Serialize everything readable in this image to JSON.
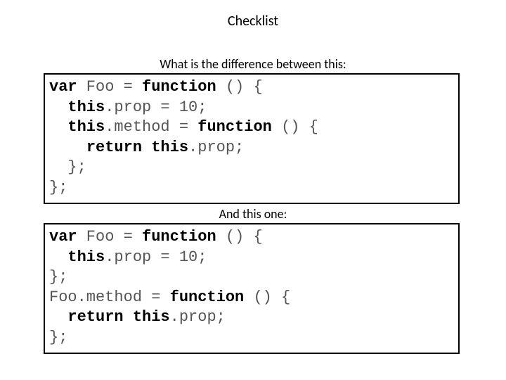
{
  "title": "Checklist",
  "captions": {
    "first": "What is the difference between this:",
    "second": "And this one:"
  },
  "code": {
    "block1": {
      "l1a": "var",
      "l1b": " Foo = ",
      "l1c": "function",
      "l1d": " () {",
      "l2a": "  ",
      "l2b": "this",
      "l2c": ".prop = 10;",
      "l3a": "  ",
      "l3b": "this",
      "l3c": ".method = ",
      "l3d": "function",
      "l3e": " () {",
      "l4a": "    ",
      "l4b": "return this",
      "l4c": ".prop;",
      "l5": "  };",
      "l6": "};"
    },
    "block2": {
      "l1a": "var",
      "l1b": " Foo = ",
      "l1c": "function",
      "l1d": " () {",
      "l2a": "  ",
      "l2b": "this",
      "l2c": ".prop = 10;",
      "l3": "};",
      "l4a": "Foo.method = ",
      "l4b": "function",
      "l4c": " () {",
      "l5a": "  ",
      "l5b": "return this",
      "l5c": ".prop;",
      "l6": "};"
    }
  }
}
